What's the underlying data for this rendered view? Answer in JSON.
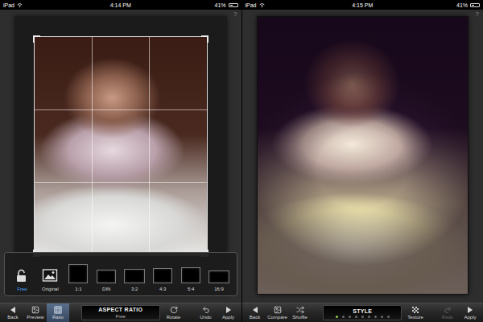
{
  "screens": [
    {
      "kind": "crop",
      "status_bar": {
        "device": "iPad",
        "time": "4:14 PM",
        "battery": "41%",
        "battery_level": 0.41
      },
      "help": "?",
      "ratio_menu": [
        {
          "label": "Free",
          "kind": "lock",
          "selected": true
        },
        {
          "label": "Original",
          "kind": "image",
          "selected": false
        },
        {
          "label": "1:1",
          "kind": "frame",
          "selected": false
        },
        {
          "label": "DIN",
          "kind": "frame",
          "selected": false
        },
        {
          "label": "3:2",
          "kind": "frame",
          "selected": false
        },
        {
          "label": "4:3",
          "kind": "frame",
          "selected": false
        },
        {
          "label": "5:4",
          "kind": "frame",
          "selected": false
        },
        {
          "label": "16:9",
          "kind": "frame",
          "selected": false
        }
      ],
      "toolbar": {
        "left": [
          {
            "label": "Back",
            "kind": "back",
            "selected": false,
            "disabled": false
          },
          {
            "label": "Preview",
            "kind": "image",
            "selected": false,
            "disabled": false
          },
          {
            "label": "Ratio",
            "kind": "grid",
            "selected": true,
            "disabled": false
          }
        ],
        "center": {
          "title": "ASPECT RATIO",
          "value": "Free"
        },
        "right": [
          {
            "label": "Rotate",
            "kind": "rotate",
            "selected": false,
            "disabled": false
          },
          {
            "label": "Undo",
            "kind": "undo",
            "selected": false,
            "disabled": false
          },
          {
            "label": "Apply",
            "kind": "apply",
            "selected": false,
            "disabled": false
          }
        ]
      }
    },
    {
      "kind": "style",
      "status_bar": {
        "device": "iPad",
        "time": "4:15 PM",
        "battery": "41%",
        "battery_level": 0.41
      },
      "help": "?",
      "toolbar": {
        "left": [
          {
            "label": "Back",
            "kind": "back",
            "selected": false,
            "disabled": false
          },
          {
            "label": "Compare",
            "kind": "image",
            "selected": false,
            "disabled": false
          },
          {
            "label": "Shuffle",
            "kind": "shuffle",
            "selected": false,
            "disabled": false
          }
        ],
        "center": {
          "title": "STYLE",
          "steps": [
            {
              "selected": true
            },
            {
              "selected": false
            },
            {
              "selected": false
            },
            {
              "selected": false
            },
            {
              "selected": false
            },
            {
              "selected": false
            },
            {
              "selected": false
            },
            {
              "selected": false
            },
            {
              "selected": false
            }
          ]
        },
        "right": [
          {
            "label": "Texture",
            "kind": "texture",
            "selected": false,
            "disabled": false
          },
          {
            "label": "Redo",
            "kind": "redo",
            "selected": false,
            "disabled": true
          },
          {
            "label": "Apply",
            "kind": "apply",
            "selected": false,
            "disabled": false
          }
        ]
      }
    }
  ]
}
